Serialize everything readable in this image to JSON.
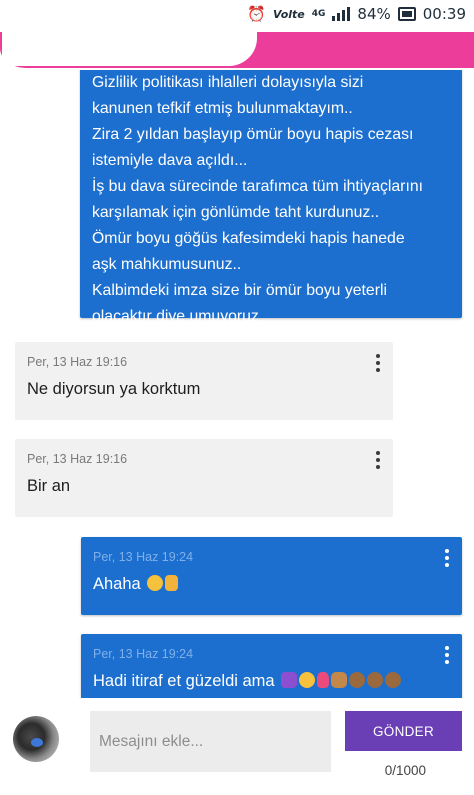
{
  "status_bar": {
    "alarm_icon": "alarm-clock-icon",
    "network_label": "Volte",
    "lte_label": "4G",
    "battery_percent": "84%",
    "time": "00:39"
  },
  "header": {
    "accent_color": "#ec3d9a"
  },
  "messages": [
    {
      "direction": "sent",
      "lines": [
        "Gizlilik politikası ihlalleri dolayısıyla sizi",
        "kanunen tefkif etmiş bulunmaktayım..",
        "Zira 2 yıldan başlayıp ömür boyu hapis cezası",
        "istemiyle dava açıldı...",
        "İş bu dava sürecinde tarafımca tüm ihtiyaçlarını",
        "karşılamak için gönlümde taht kurdunuz..",
        "Ömür boyu göğüs kafesimdeki hapis hanede",
        "aşk mahkumusunuz..",
        "Kalbimdeki imza size bir ömür boyu yeterli",
        "olacaktır diye umuyoruz"
      ]
    },
    {
      "direction": "received",
      "meta": "Per, 13 Haz 19:16",
      "text": "Ne diyorsun ya korktum"
    },
    {
      "direction": "received",
      "meta": "Per, 13 Haz 19:16",
      "text": "Bir an"
    },
    {
      "direction": "sent",
      "meta": "Per, 13 Haz 19:24",
      "text": "Ahaha",
      "emojis": [
        "laughing-emoji",
        "thumbs-up-emoji"
      ]
    },
    {
      "direction": "sent",
      "meta": "Per, 13 Haz 19:24",
      "text": "Hadi itiraf et güzeldi ama",
      "emojis": [
        "woman-gesturing-emoji",
        "rolling-eyes-emoji",
        "tulip-emoji",
        "person-emoji",
        "see-no-evil-monkey-emoji",
        "see-no-evil-monkey-emoji",
        "see-no-evil-monkey-emoji"
      ]
    }
  ],
  "composer": {
    "placeholder": "Mesajını ekle...",
    "send_label": "GÖNDER",
    "char_counter": "0/1000",
    "send_color": "#6a3fb5"
  },
  "colors": {
    "sent_bubble": "#1c6fce",
    "received_bubble": "#f1f1f1"
  }
}
